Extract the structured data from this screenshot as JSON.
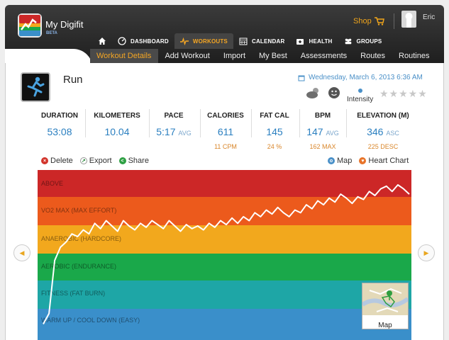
{
  "app": {
    "name": "My Digifit",
    "badge": "BETA"
  },
  "header": {
    "shop_label": "Shop",
    "user_name": "Eric"
  },
  "main_nav": [
    {
      "label": "",
      "icon": "home-icon"
    },
    {
      "label": "DASHBOARD",
      "icon": "dashboard-icon"
    },
    {
      "label": "WORKOUTS",
      "icon": "heartbeat-icon",
      "active": true
    },
    {
      "label": "CALENDAR",
      "icon": "calendar-icon"
    },
    {
      "label": "HEALTH",
      "icon": "medkit-icon"
    },
    {
      "label": "GROUPS",
      "icon": "group-icon"
    }
  ],
  "sub_nav": [
    {
      "label": "Workout Details",
      "active": true
    },
    {
      "label": "Add Workout"
    },
    {
      "label": "Import"
    },
    {
      "label": "My Best"
    },
    {
      "label": "Assessments"
    },
    {
      "label": "Routes"
    },
    {
      "label": "Routines"
    }
  ],
  "workout": {
    "title": "Run",
    "date": "Wednesday, March 6, 2013 6:36 AM",
    "intensity_label": "Intensity",
    "rating": 0,
    "rating_max": 5
  },
  "stats": [
    {
      "label": "DURATION",
      "value": "53:08",
      "unit": "",
      "sub": ""
    },
    {
      "label": "KILOMETERS",
      "value": "10.04",
      "unit": "",
      "sub": ""
    },
    {
      "label": "PACE",
      "value": "5:17",
      "unit": "AVG",
      "sub": ""
    },
    {
      "label": "CALORIES",
      "value": "611",
      "unit": "",
      "sub": "11 CPM"
    },
    {
      "label": "FAT CAL",
      "value": "145",
      "unit": "",
      "sub": "24 %"
    },
    {
      "label": "BPM",
      "value": "147",
      "unit": "AVG",
      "sub": "162 MAX"
    },
    {
      "label": "ELEVATION (M)",
      "value": "346",
      "unit": "ASC",
      "sub": "225 DESC"
    }
  ],
  "actions": {
    "delete": "Delete",
    "export": "Export",
    "share": "Share",
    "map": "Map",
    "heart_chart": "Heart Chart"
  },
  "zones": [
    {
      "label": "ABOVE",
      "color": "#cc2727"
    },
    {
      "label": "VO2 MAX  (MAX EFFORT)",
      "color": "#ec5a1c"
    },
    {
      "label": "ANAEROBIC  (HARDCORE)",
      "color": "#f2a81d"
    },
    {
      "label": "AEROBIC  (ENDURANCE)",
      "color": "#1aa84a"
    },
    {
      "label": "FITNESS  (FAT BURN)",
      "color": "#1ea6a6"
    },
    {
      "label": "WARM UP / COOL DOWN (EASY)",
      "color": "#3a8fca"
    }
  ],
  "heart_rate_series": [
    0.12,
    0.2,
    0.6,
    0.7,
    0.74,
    0.8,
    0.78,
    0.83,
    0.8,
    0.88,
    0.84,
    0.9,
    0.86,
    0.82,
    0.9,
    0.86,
    0.83,
    0.88,
    0.85,
    0.9,
    0.87,
    0.84,
    0.9,
    0.86,
    0.82,
    0.87,
    0.84,
    0.86,
    0.83,
    0.88,
    0.85,
    0.9,
    0.87,
    0.92,
    0.88,
    0.93,
    0.9,
    0.96,
    0.93,
    0.98,
    0.95,
    1.0,
    0.96,
    0.93,
    0.98,
    0.96,
    1.02,
    0.99,
    1.05,
    1.02,
    1.07,
    1.04,
    1.1,
    1.07,
    1.03,
    1.08,
    1.06,
    1.12,
    1.09,
    1.14,
    1.16,
    1.12,
    1.17,
    1.14,
    1.1
  ],
  "map_thumb": {
    "label": "Map"
  }
}
